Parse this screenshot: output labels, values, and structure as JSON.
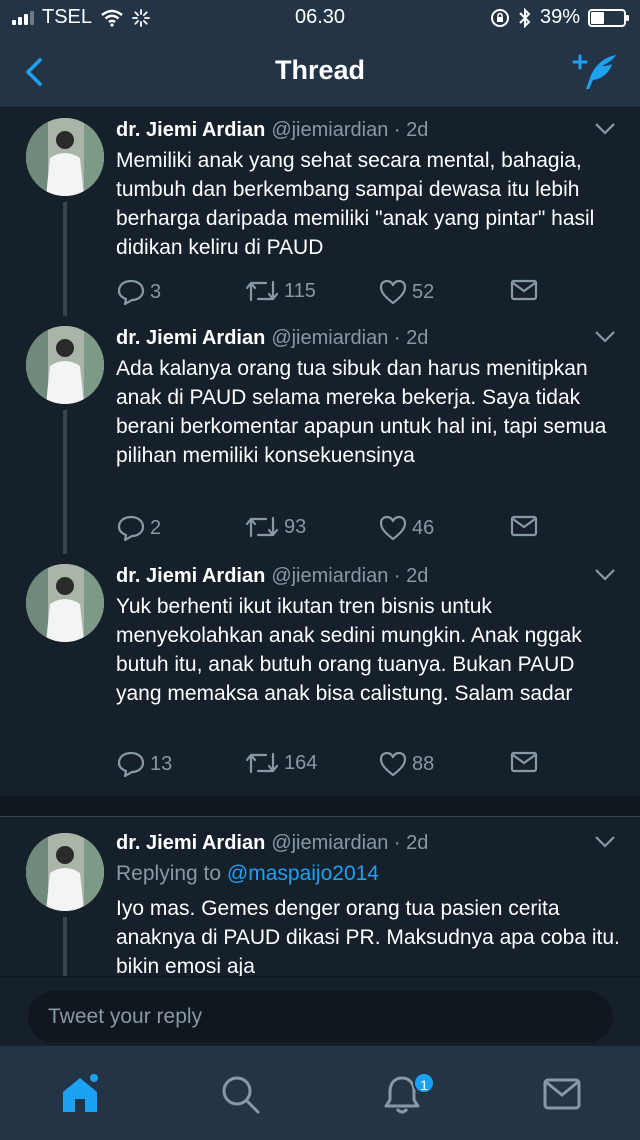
{
  "status_bar": {
    "carrier": "TSEL",
    "time": "06.30",
    "battery": "39%",
    "battery_level": 0.39
  },
  "nav": {
    "title": "Thread",
    "back_icon": "chevron-left-icon",
    "compose_icon": "compose-tweet-icon"
  },
  "tweets": [
    {
      "name": "dr. Jiemi Ardian",
      "handle": "@jiemiardian · 2d",
      "text": "Memiliki anak yang sehat secara mental, bahagia, tumbuh dan berkembang sampai dewasa itu lebih berharga daripada memiliki \"anak yang pintar\" hasil didikan keliru di PAUD",
      "replies": "3",
      "retweets": "115",
      "likes": "52"
    },
    {
      "name": "dr. Jiemi Ardian",
      "handle": "@jiemiardian · 2d",
      "text": "Ada kalanya orang tua sibuk dan harus menitipkan anak di PAUD selama mereka bekerja. Saya tidak berani berkomentar apapun untuk hal ini, tapi semua pilihan memiliki konsekuensinya",
      "replies": "2",
      "retweets": "93",
      "likes": "46"
    },
    {
      "name": "dr. Jiemi Ardian",
      "handle": "@jiemiardian · 2d",
      "text": "Yuk berhenti ikut ikutan tren bisnis untuk menyekolahkan anak sedini mungkin. Anak nggak butuh itu, anak butuh orang tuanya. Bukan PAUD yang memaksa anak bisa calistung. Salam sadar",
      "replies": "13",
      "retweets": "164",
      "likes": "88"
    },
    {
      "name": "dr. Jiemi Ardian",
      "handle": "@jiemiardian · 2d",
      "replying_prefix": "Replying to",
      "replying_handle": "@maspaijo2014",
      "text": "Iyo mas. Gemes denger orang tua pasien cerita anaknya di PAUD dikasi PR. Maksudnya apa coba itu. bikin emosi aja"
    }
  ],
  "reply_box": {
    "placeholder": "Tweet your reply"
  },
  "tab_bar": {
    "items": [
      "home-icon",
      "search-icon",
      "notifications-icon",
      "messages-icon"
    ],
    "notification_badge": "1"
  },
  "colors": {
    "background": "#15202b",
    "bar": "#243447",
    "accent": "#1da1f2",
    "muted": "#8899a6"
  }
}
